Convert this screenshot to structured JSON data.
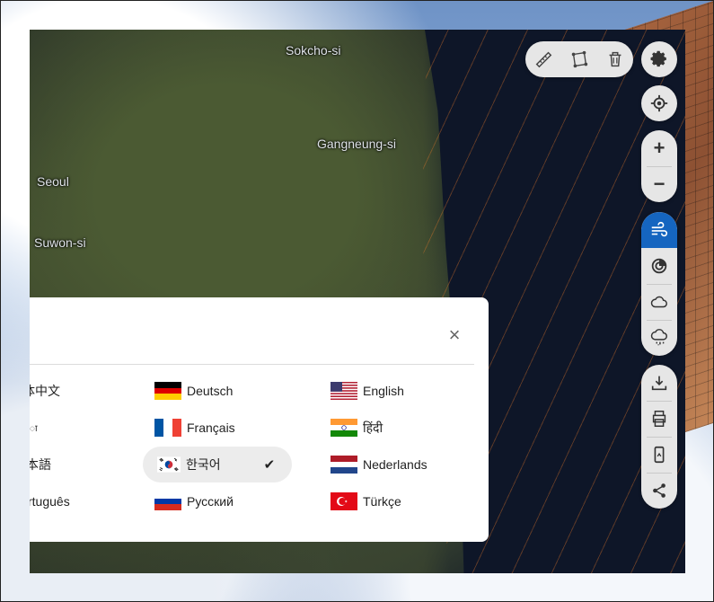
{
  "map": {
    "cities": [
      "Sokcho-si",
      "Gangneung-si",
      "Seoul",
      "Suwon-si"
    ]
  },
  "toolbar": {
    "measure": "ruler-icon",
    "area": "polygon-icon",
    "delete": "trash-icon",
    "settings": "gear-icon",
    "locate": "location-icon",
    "zoom_in": "+",
    "zoom_out": "−"
  },
  "layers": [
    "wind-icon",
    "pressure-icon",
    "cloud-icon",
    "rain-icon"
  ],
  "tools": [
    "download-icon",
    "print-icon",
    "mobile-icon",
    "share-icon"
  ],
  "language_dialog": {
    "close": "×",
    "languages": [
      {
        "label": "体中文",
        "flag": "cn"
      },
      {
        "label": "Deutsch",
        "flag": "de"
      },
      {
        "label": "English",
        "flag": "us"
      },
      {
        "label": "ा",
        "flag": "none"
      },
      {
        "label": "Français",
        "flag": "fr"
      },
      {
        "label": "हिंदी",
        "flag": "in"
      },
      {
        "label": "本語",
        "flag": "jp"
      },
      {
        "label": "한국어",
        "flag": "kr",
        "selected": true,
        "check": "✔"
      },
      {
        "label": "Nederlands",
        "flag": "nl"
      },
      {
        "label": "rtuguês",
        "flag": "pt"
      },
      {
        "label": "Русский",
        "flag": "ru"
      },
      {
        "label": "Türkçe",
        "flag": "tr"
      }
    ]
  },
  "colors": {
    "active_layer": "#1565c0",
    "panel": "#e6e6e6"
  }
}
